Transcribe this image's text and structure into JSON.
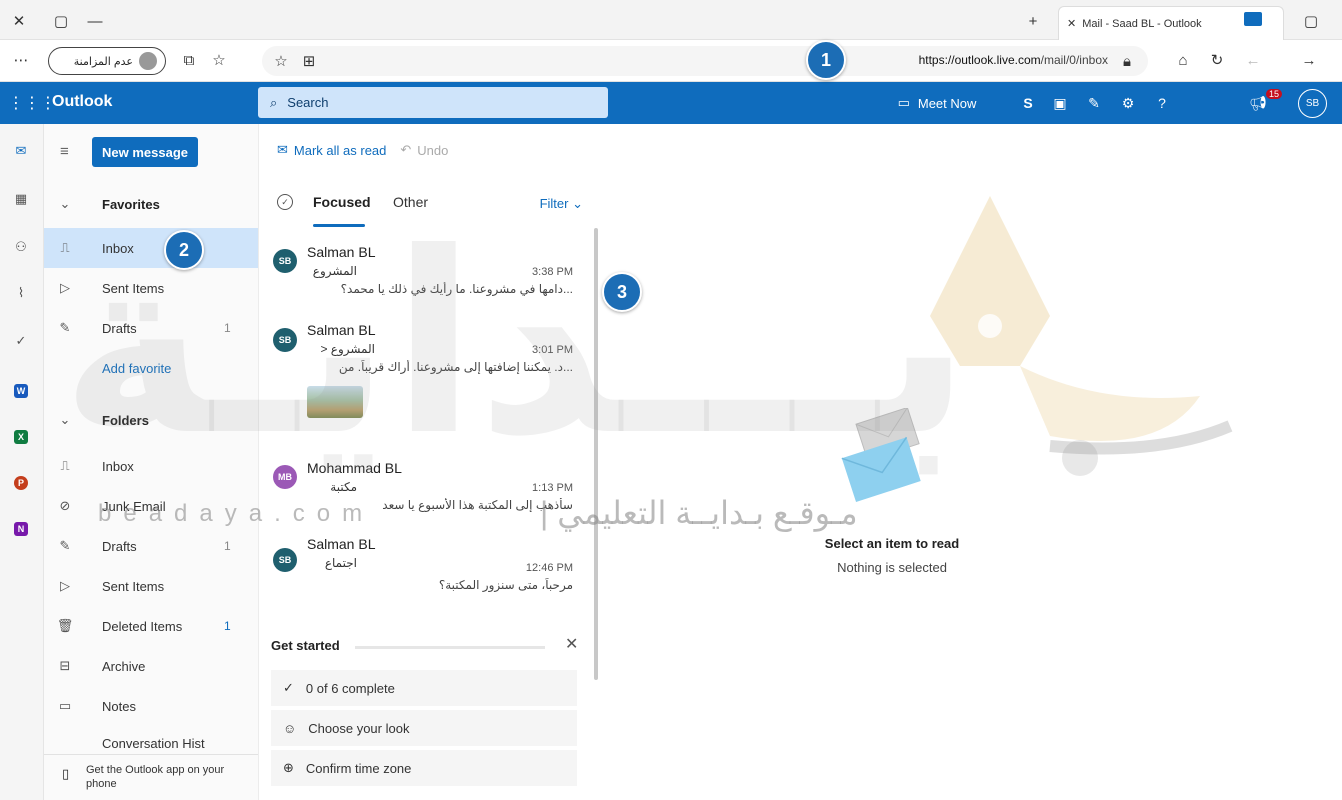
{
  "browser": {
    "tab_title": "Mail - Saad BL - Outlook",
    "guest_label": "عدم المزامنة",
    "url_host": "https://outlook.live.com",
    "url_path": "/mail/0/inbox",
    "more_label": "⋯"
  },
  "header": {
    "brand": "Outlook",
    "search_placeholder": "Search",
    "meet_now": "Meet Now",
    "notification_count": "15",
    "avatar_initials": "SB"
  },
  "folder_pane": {
    "new_message": "New message",
    "favorites_heading": "Favorites",
    "favorites": [
      {
        "label": "Inbox",
        "count": ""
      },
      {
        "label": "Sent Items",
        "count": ""
      },
      {
        "label": "Drafts",
        "count": "1"
      }
    ],
    "add_favorite": "Add favorite",
    "folders_heading": "Folders",
    "folders": [
      {
        "label": "Inbox",
        "count": ""
      },
      {
        "label": "Junk Email",
        "count": ""
      },
      {
        "label": "Drafts",
        "count": "1"
      },
      {
        "label": "Sent Items",
        "count": ""
      },
      {
        "label": "Deleted Items",
        "count": "1"
      },
      {
        "label": "Archive",
        "count": ""
      },
      {
        "label": "Notes",
        "count": ""
      },
      {
        "label": "Conversation Hist",
        "count": ""
      }
    ],
    "get_app": "Get the Outlook app on your phone"
  },
  "message_list": {
    "mark_all_read": "Mark all as read",
    "undo": "Undo",
    "tab_focused": "Focused",
    "tab_other": "Other",
    "filter": "Filter",
    "messages": [
      {
        "initials": "SB",
        "sender": "Salman BL",
        "subject": "المشروع",
        "time": "3:38 PM",
        "preview": "...دامها في مشروعنا. ما رأيك في ذلك يا محمد؟",
        "color": "#1f5f6e"
      },
      {
        "initials": "SB",
        "sender": "Salman BL",
        "subject": "المشروع <",
        "time": "3:01 PM",
        "preview": "...د. يمكننا إضافتها إلى مشروعنا. أراك قريباً. من",
        "color": "#1f5f6e"
      },
      {
        "initials": "MB",
        "sender": "Mohammad BL",
        "subject": "مكتبة",
        "time": "1:13 PM",
        "preview": "سأذهب إلى المكتبة هذا الأسبوع يا سعد",
        "color": "#9b59b6"
      },
      {
        "initials": "SB",
        "sender": "Salman BL",
        "subject": "اجتماع",
        "time": "12:46 PM",
        "preview": "مرحباً، متى سنزور المكتبة؟",
        "color": "#1f5f6e"
      }
    ],
    "get_started": {
      "heading": "Get started",
      "items": [
        "0 of 6 complete",
        "Choose your look",
        "Confirm time zone"
      ]
    }
  },
  "reading_pane": {
    "title": "Select an item to read",
    "subtitle": "Nothing is selected"
  },
  "watermark": {
    "arabic_logo": "بـــدايـة",
    "site": "beadaya.com",
    "tagline": "مـوقـع بـدايــة التعليمي |"
  },
  "callouts": [
    "1",
    "2",
    "3"
  ],
  "colors": {
    "accent": "#0f6cbd",
    "callout": "#1c6db5"
  }
}
